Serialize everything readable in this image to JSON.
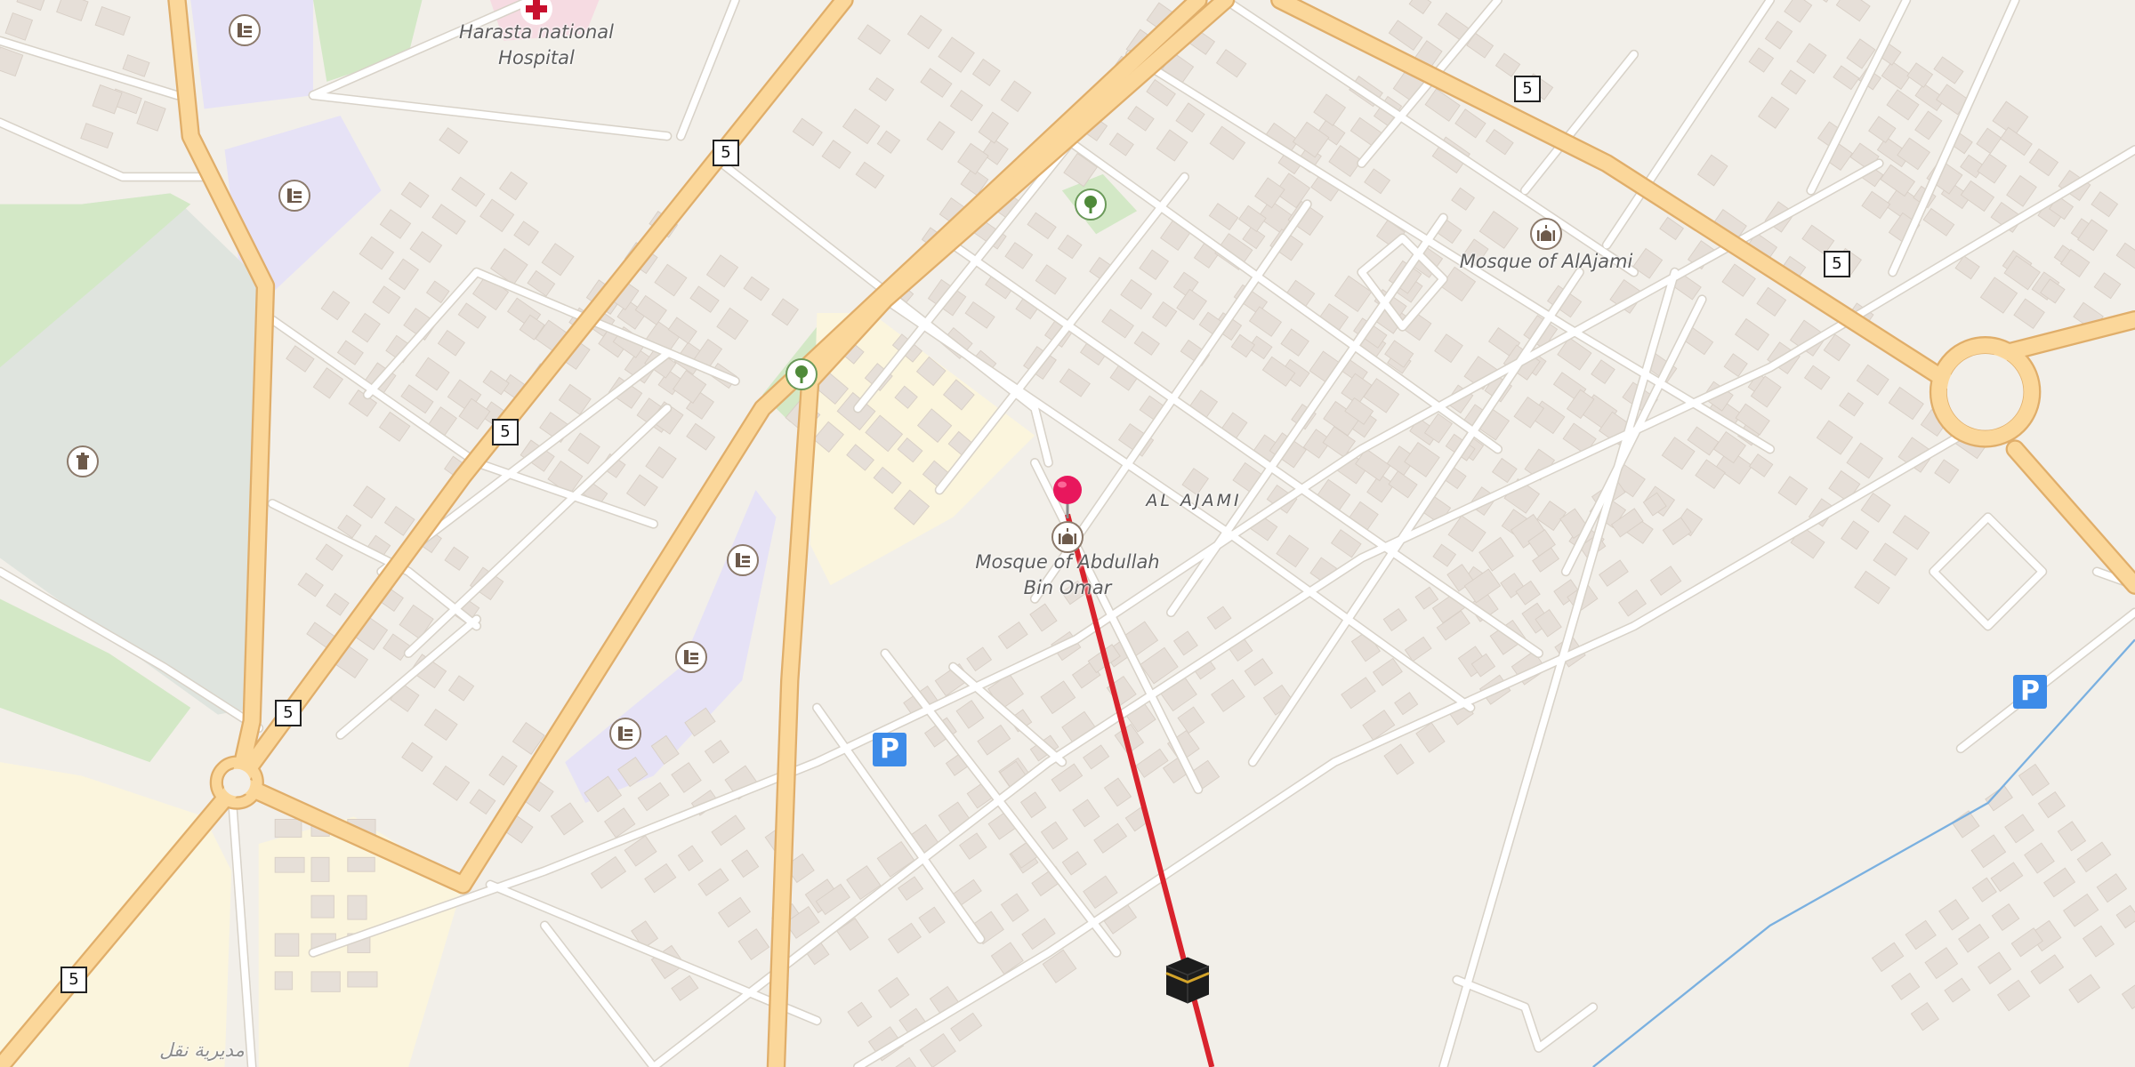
{
  "map": {
    "route_color": "#d9232d",
    "pin_color": "#e8175d",
    "colors": {
      "background": "#f2efe9",
      "building": "#e6dfd8",
      "major_road": "#fbd79a",
      "major_road_casing": "#e0ae6a",
      "minor_road": "#ffffff",
      "minor_road_casing": "#d8d2c8",
      "park": "#d3e8c6",
      "cemetery": "#dfe4de",
      "school_area": "#e6e2f6",
      "residential_yellow": "#fbf5dd",
      "hospital_area": "#f6dbe2",
      "water_line": "#7ab0e0"
    }
  },
  "labels": {
    "hospital": "Harasta national\nHospital",
    "mosque_alajami": "Mosque of AlAjami",
    "mosque_abdullah": "Mosque of Abdullah\nBin Omar",
    "al_ajami": "AL AJAMI",
    "arabic_town": "مديرية نقل"
  },
  "shields": [
    "5",
    "5",
    "5",
    "5",
    "5",
    "5"
  ],
  "icons": {
    "school": "school-icon",
    "park": "tree-icon",
    "mosque": "mosque-icon",
    "cemetery": "cemetery-icon",
    "hospital": "hospital-cross-icon",
    "parking": "parking-icon",
    "pin": "location-pin-icon",
    "kaaba": "kaaba-icon"
  },
  "parking_label": "P"
}
